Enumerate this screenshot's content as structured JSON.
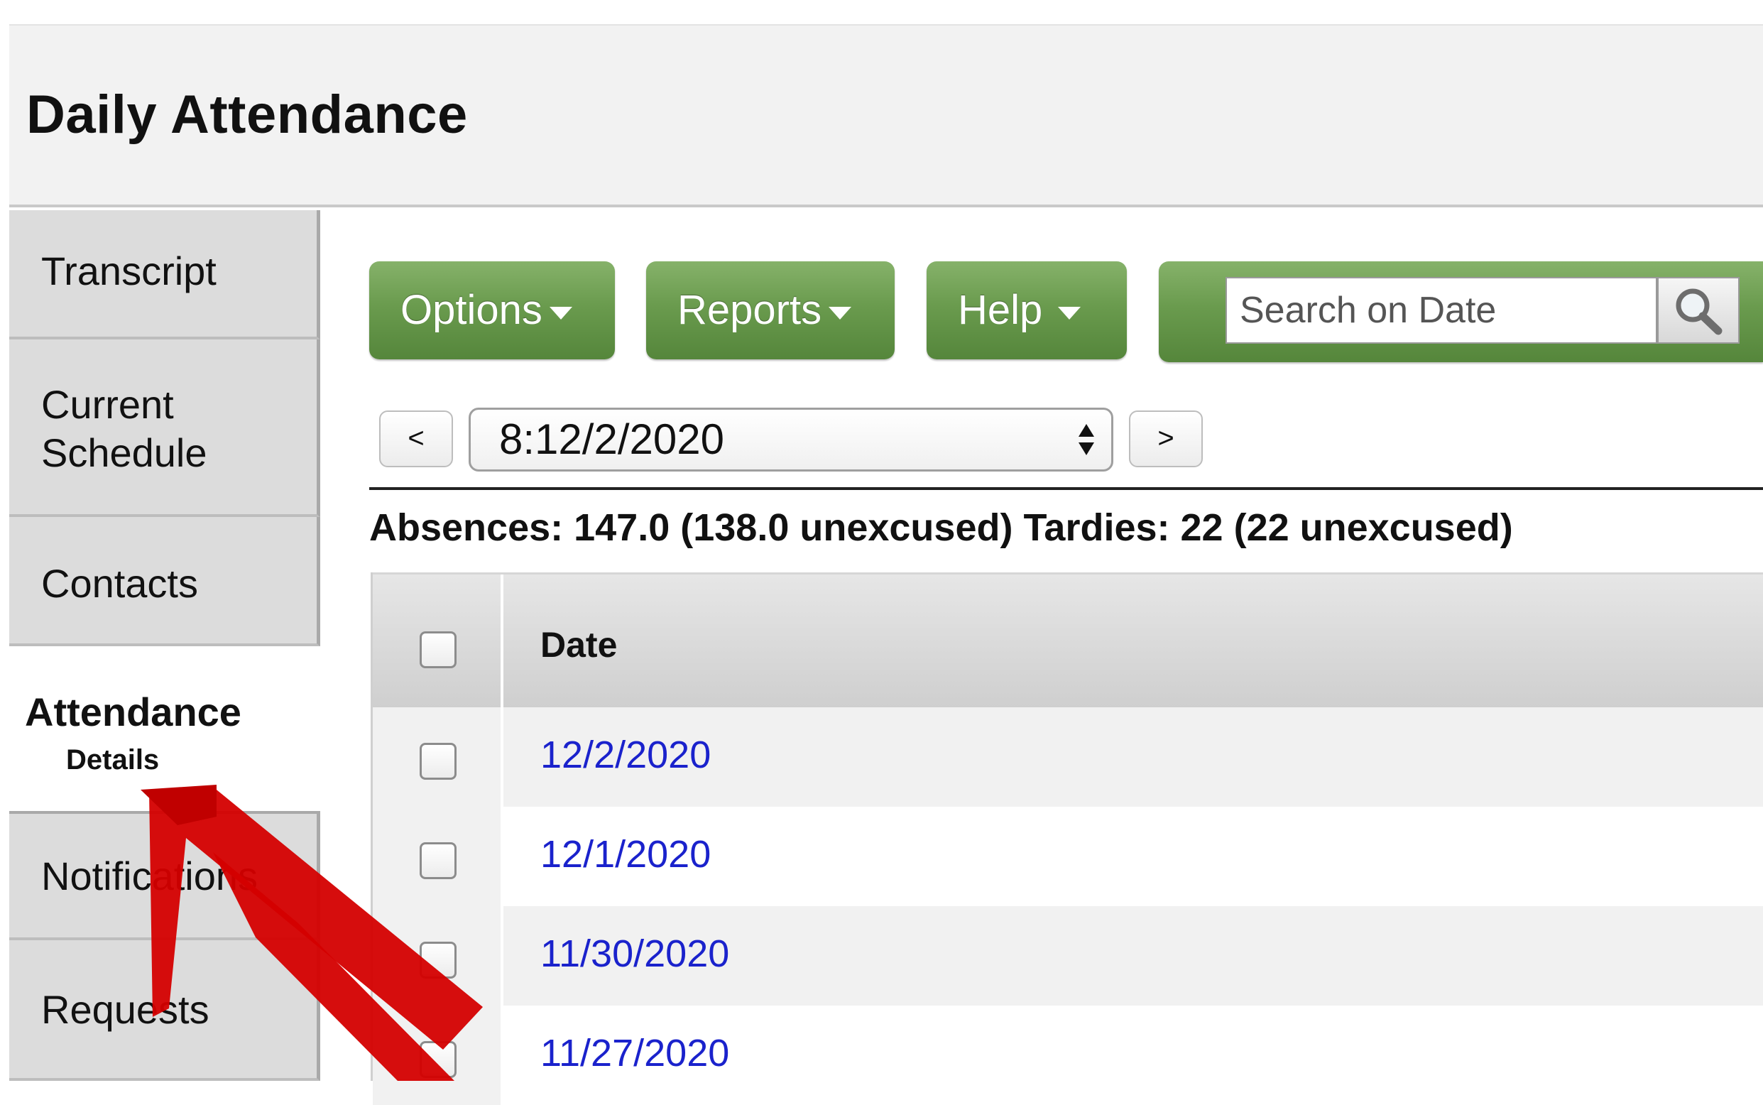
{
  "page": {
    "title": "Daily Attendance"
  },
  "sidebar": {
    "items": [
      {
        "label": "Transcript"
      },
      {
        "label": "Current Schedule"
      },
      {
        "label": "Contacts"
      },
      {
        "label": "Attendance",
        "sub_label": "Details",
        "active": true
      },
      {
        "label": "Notifications"
      },
      {
        "label": "Requests"
      }
    ]
  },
  "toolbar": {
    "options_label": "Options",
    "reports_label": "Reports",
    "help_label": "Help",
    "search": {
      "placeholder": "Search on Date",
      "value": "",
      "icon": "magnifier-icon"
    }
  },
  "date_nav": {
    "prev_label": "<",
    "selected": "8:12/2/2020",
    "next_label": ">"
  },
  "summary": "Absences: 147.0 (138.0 unexcused) Tardies: 22 (22 unexcused)",
  "table": {
    "columns": [
      "",
      "Date"
    ],
    "rows": [
      {
        "date": "12/2/2020"
      },
      {
        "date": "12/1/2020"
      },
      {
        "date": "11/30/2020"
      },
      {
        "date": "11/27/2020"
      }
    ]
  },
  "colors": {
    "button_green": "#6a9b4e",
    "link_blue": "#1a22cc",
    "annotation_red": "#d40000"
  }
}
